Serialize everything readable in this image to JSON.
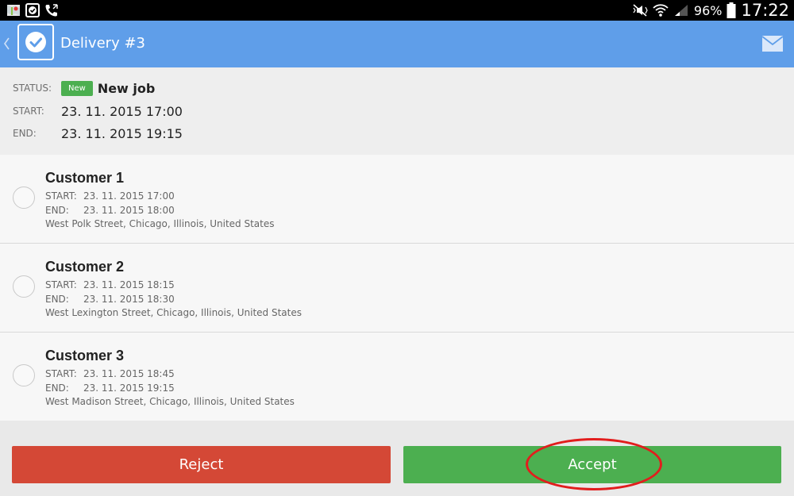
{
  "statusbar": {
    "battery": "96%",
    "time": "17:22"
  },
  "appbar": {
    "title": "Delivery #3"
  },
  "summary": {
    "status_label": "STATUS:",
    "status_badge": "New",
    "status_text": "New job",
    "start_label": "START:",
    "start_value": "23. 11. 2015 17:00",
    "end_label": "END:",
    "end_value": "23. 11. 2015 19:15"
  },
  "customers": [
    {
      "name": "Customer 1",
      "start_label": "START:",
      "start": "23. 11. 2015 17:00",
      "end_label": "END:",
      "end": "23. 11. 2015 18:00",
      "address": "West Polk Street, Chicago, Illinois, United States"
    },
    {
      "name": "Customer 2",
      "start_label": "START:",
      "start": "23. 11. 2015 18:15",
      "end_label": "END:",
      "end": "23. 11. 2015 18:30",
      "address": "West Lexington Street, Chicago, Illinois, United States"
    },
    {
      "name": "Customer 3",
      "start_label": "START:",
      "start": "23. 11. 2015 18:45",
      "end_label": "END:",
      "end": "23. 11. 2015 19:15",
      "address": "West Madison Street, Chicago, Illinois, United States"
    }
  ],
  "footer": {
    "reject_label": "Reject",
    "accept_label": "Accept"
  },
  "colors": {
    "appbar": "#5f9ee9",
    "badge": "#4caf50",
    "reject": "#d44836",
    "accept": "#4caf50",
    "annotation": "#e21d1d"
  }
}
